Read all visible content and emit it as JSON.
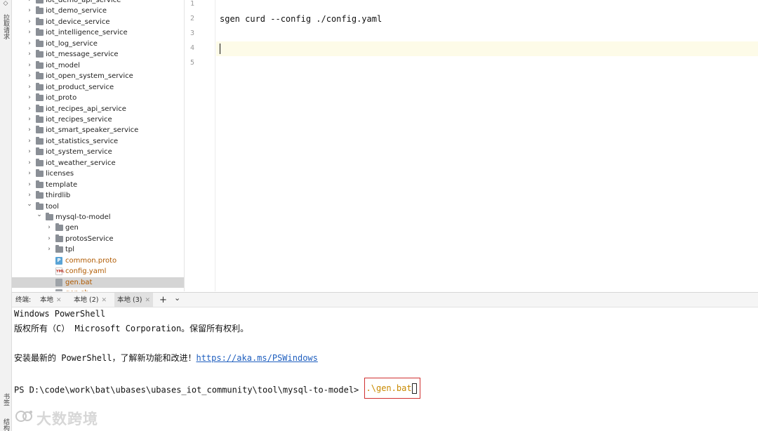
{
  "strip": {
    "label_pull": "拉取请求",
    "label_bookmark": "书签",
    "label_structure": "结构"
  },
  "tree": {
    "items": [
      {
        "label": "iot_demo_api_service",
        "kind": "folder",
        "indent": 0,
        "expanded": false
      },
      {
        "label": "iot_demo_service",
        "kind": "folder",
        "indent": 0,
        "expanded": false
      },
      {
        "label": "iot_device_service",
        "kind": "folder",
        "indent": 0,
        "expanded": false
      },
      {
        "label": "iot_intelligence_service",
        "kind": "folder",
        "indent": 0,
        "expanded": false
      },
      {
        "label": "iot_log_service",
        "kind": "folder",
        "indent": 0,
        "expanded": false
      },
      {
        "label": "iot_message_service",
        "kind": "folder",
        "indent": 0,
        "expanded": false
      },
      {
        "label": "iot_model",
        "kind": "folder",
        "indent": 0,
        "expanded": false
      },
      {
        "label": "iot_open_system_service",
        "kind": "folder",
        "indent": 0,
        "expanded": false
      },
      {
        "label": "iot_product_service",
        "kind": "folder",
        "indent": 0,
        "expanded": false
      },
      {
        "label": "iot_proto",
        "kind": "folder",
        "indent": 0,
        "expanded": false
      },
      {
        "label": "iot_recipes_api_service",
        "kind": "folder",
        "indent": 0,
        "expanded": false
      },
      {
        "label": "iot_recipes_service",
        "kind": "folder",
        "indent": 0,
        "expanded": false
      },
      {
        "label": "iot_smart_speaker_service",
        "kind": "folder",
        "indent": 0,
        "expanded": false
      },
      {
        "label": "iot_statistics_service",
        "kind": "folder",
        "indent": 0,
        "expanded": false
      },
      {
        "label": "iot_system_service",
        "kind": "folder",
        "indent": 0,
        "expanded": false
      },
      {
        "label": "iot_weather_service",
        "kind": "folder",
        "indent": 0,
        "expanded": false
      },
      {
        "label": "licenses",
        "kind": "folder",
        "indent": 0,
        "expanded": false
      },
      {
        "label": "template",
        "kind": "folder",
        "indent": 0,
        "expanded": false
      },
      {
        "label": "thirdlib",
        "kind": "folder",
        "indent": 0,
        "expanded": false
      },
      {
        "label": "tool",
        "kind": "folder",
        "indent": 0,
        "expanded": true
      },
      {
        "label": "mysql-to-model",
        "kind": "folder",
        "indent": 1,
        "expanded": true
      },
      {
        "label": "gen",
        "kind": "folder",
        "indent": 2,
        "expanded": false
      },
      {
        "label": "protosService",
        "kind": "folder",
        "indent": 2,
        "expanded": false
      },
      {
        "label": "tpl",
        "kind": "folder",
        "indent": 2,
        "expanded": false
      },
      {
        "label": "common.proto",
        "kind": "proto",
        "indent": 2,
        "icon_text": "P"
      },
      {
        "label": "config.yaml",
        "kind": "yaml",
        "indent": 2,
        "icon_text": "YML"
      },
      {
        "label": "gen.bat",
        "kind": "bat",
        "indent": 2,
        "selected": true
      },
      {
        "label": "gen.sh",
        "kind": "bat",
        "indent": 2
      }
    ]
  },
  "editor": {
    "line_numbers": [
      "1",
      "2",
      "3",
      "4",
      "5"
    ],
    "lines": [
      "",
      "sgen curd --config ./config.yaml",
      "",
      "",
      ""
    ],
    "current_line": 4
  },
  "terminal": {
    "title": "终端:",
    "tabs": [
      {
        "label": "本地",
        "active": false
      },
      {
        "label": "本地 (2)",
        "active": false
      },
      {
        "label": "本地 (3)",
        "active": true
      }
    ],
    "add_symbol": "+",
    "dropdown_symbol": "⌄",
    "line1": "Windows PowerShell",
    "line2": "版权所有（C） Microsoft Corporation。保留所有权利。",
    "line3_prefix": "安装最新的 PowerShell，了解新功能和改进！",
    "line3_link": "https://aka.ms/PSWindows",
    "prompt": "PS D:\\code\\work\\bat\\ubases\\ubases_iot_community\\tool\\mysql-to-model>",
    "command": ".\\gen.bat"
  },
  "watermark": {
    "text": "大数跨境"
  },
  "colors": {
    "accent_link": "#1f5fbf",
    "command_text": "#c98a00",
    "highlight_box": "#d03030",
    "selected_row": "#d5d5d5"
  }
}
